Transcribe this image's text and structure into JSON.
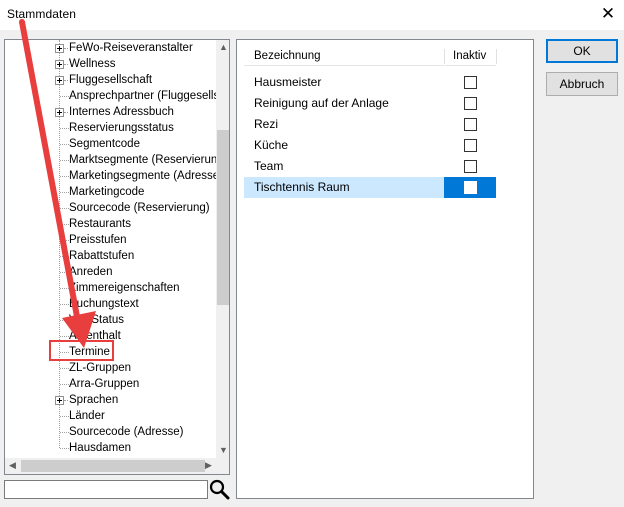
{
  "window": {
    "title": "Stammdaten",
    "close_glyph": "✕"
  },
  "tree": {
    "items": [
      {
        "label": "FeWo-Reiseveranstalter",
        "expandable": true
      },
      {
        "label": "Wellness",
        "expandable": true
      },
      {
        "label": "Fluggesellschaft",
        "expandable": true
      },
      {
        "label": "Ansprechpartner (Fluggesellsc",
        "expandable": false
      },
      {
        "label": "Internes Adressbuch",
        "expandable": true
      },
      {
        "label": "Reservierungsstatus",
        "expandable": false
      },
      {
        "label": "Segmentcode",
        "expandable": false
      },
      {
        "label": "Marktsegmente (Reservierun",
        "expandable": false
      },
      {
        "label": "Marketingsegmente (Adresse)",
        "expandable": false
      },
      {
        "label": "Marketingcode",
        "expandable": false
      },
      {
        "label": "Sourcecode (Reservierung)",
        "expandable": false
      },
      {
        "label": "Restaurants",
        "expandable": false
      },
      {
        "label": "Preisstufen",
        "expandable": false
      },
      {
        "label": "Rabattstufen",
        "expandable": false
      },
      {
        "label": "Anreden",
        "expandable": false
      },
      {
        "label": "Zimmereigenschaften",
        "expandable": false
      },
      {
        "label": "Buchungstext",
        "expandable": false
      },
      {
        "label": "VIP-Status",
        "expandable": false
      },
      {
        "label": "Aufenthalt",
        "expandable": false
      },
      {
        "label": "Termine",
        "expandable": false,
        "highlighted": true
      },
      {
        "label": "ZL-Gruppen",
        "expandable": false
      },
      {
        "label": "Arra-Gruppen",
        "expandable": false
      },
      {
        "label": "Sprachen",
        "expandable": true
      },
      {
        "label": "Länder",
        "expandable": false
      },
      {
        "label": "Sourcecode (Adresse)",
        "expandable": false
      },
      {
        "label": "Hausdamen",
        "expandable": false
      }
    ]
  },
  "search": {
    "value": "",
    "placeholder": ""
  },
  "grid": {
    "columns": [
      "Bezeichnung",
      "Inaktiv"
    ],
    "rows": [
      {
        "name": "Hausmeister",
        "inaktiv": false,
        "selected": false
      },
      {
        "name": "Reinigung auf der Anlage",
        "inaktiv": false,
        "selected": false
      },
      {
        "name": "Rezi",
        "inaktiv": false,
        "selected": false
      },
      {
        "name": "Küche",
        "inaktiv": false,
        "selected": false
      },
      {
        "name": "Team",
        "inaktiv": false,
        "selected": false
      },
      {
        "name": "Tischtennis Raum",
        "inaktiv": false,
        "selected": true
      }
    ]
  },
  "buttons": {
    "ok": "OK",
    "cancel": "Abbruch"
  },
  "annotation": {
    "arrow_color": "#e83e3e"
  },
  "colors": {
    "selection": "#0078d7",
    "selection_light": "#cce8ff"
  }
}
